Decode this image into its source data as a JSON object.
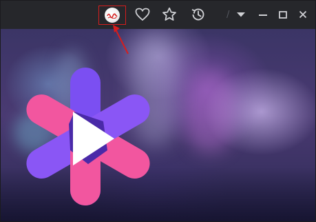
{
  "titlebar": {
    "profile_button": {
      "icon": "user-avatar-icon"
    },
    "favorite_button": {
      "icon": "heart-icon"
    },
    "bookmark_button": {
      "icon": "star-icon"
    },
    "history_button": {
      "icon": "clock-history-icon"
    },
    "separator": "/",
    "menu_button": {
      "icon": "caret-down-icon"
    },
    "minimize_button": {
      "icon": "minimize-icon"
    },
    "maximize_button": {
      "icon": "maximize-icon"
    },
    "close_button": {
      "icon": "close-icon"
    }
  },
  "annotation": {
    "highlight_color": "#d61d1d"
  },
  "content": {
    "logo": {
      "icon": "play-logo-icon",
      "colors": {
        "pink": "#f2569f",
        "purple": "#7b4ff2",
        "dark": "#4a2aa8",
        "play": "#ffffff"
      }
    }
  },
  "colors": {
    "titlebar_bg": "#26272b",
    "icon": "#cfd0d4"
  }
}
